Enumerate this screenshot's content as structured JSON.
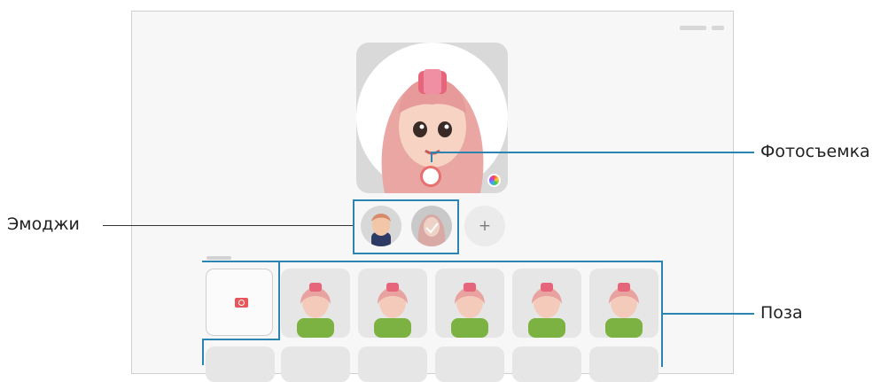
{
  "callouts": {
    "capture": "Фотосъемка",
    "emoji": "Эмоджи",
    "pose": "Поза"
  },
  "add_label": "+",
  "colors": {
    "accent_line": "#2c84b0",
    "shutter_ring": "#e8706f",
    "camera_icon": "#e8555a"
  },
  "icons": {
    "shutter": "shutter-button",
    "color": "color-palette-icon",
    "camera": "camera-icon",
    "add": "plus-icon"
  },
  "poses_count": 5
}
